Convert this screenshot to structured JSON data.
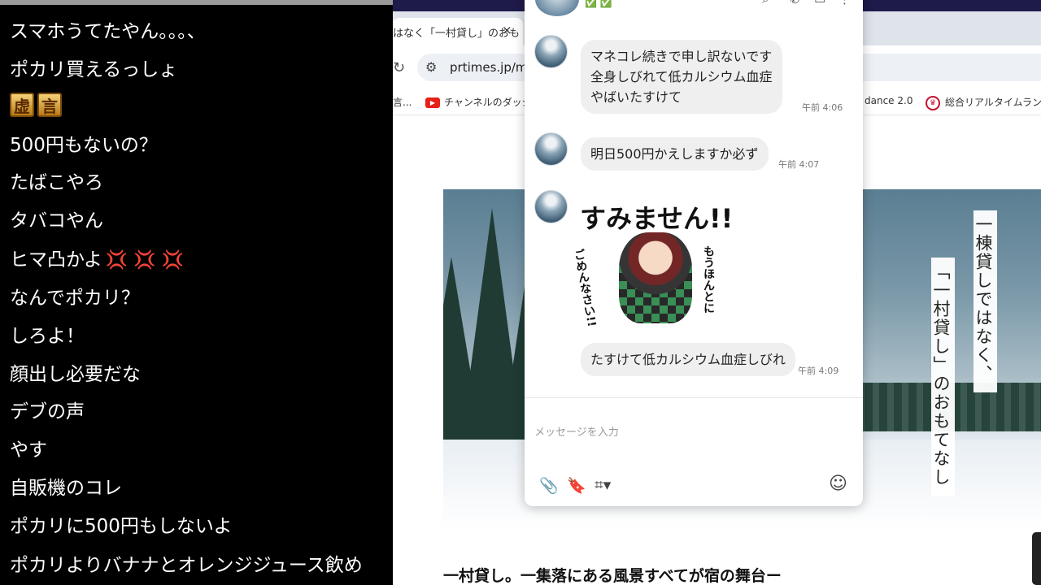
{
  "comments": [
    {
      "text": "スマホうてたやん。。。、"
    },
    {
      "text": "ポカリ買えるっしょ"
    },
    {
      "badge1": "虚",
      "badge2": "言"
    },
    {
      "text": "500円もないの？"
    },
    {
      "text": "たばこやろ"
    },
    {
      "text": "タバコやん"
    },
    {
      "text": "ヒマ凸かよ",
      "anger": "💢 💢 💢"
    },
    {
      "text": "なんでポカリ？"
    },
    {
      "text": "しろよ！"
    },
    {
      "text": "顔出し必要だな"
    },
    {
      "text": "デブの声"
    },
    {
      "text": "やす"
    },
    {
      "text": "自販機のコレ"
    },
    {
      "text": "ポカリに500円もしないよ"
    },
    {
      "text": "ポカリよりバナナとオレンジジュース飲め"
    }
  ],
  "browser": {
    "tab_title": "はなく「一村貸し」のおも",
    "tab_close": "×",
    "reload": "↻",
    "url": "prtimes.jp/ma",
    "bookmarks": {
      "item1": "言...",
      "item2": "チャンネルのダッシュ",
      "item3": "dance 2.0",
      "item4": "総合リアルタイムランキ"
    }
  },
  "hero": {
    "vertical_1": "一棟貸しではなく、",
    "vertical_2": "「一村貸し」のおもてなし"
  },
  "article": {
    "heading": "一村貸し。一集落にある風景すべてが宿の舞台ー"
  },
  "chat": {
    "header_name": "✅ ✅",
    "messages": [
      {
        "lines": [
          "マネコレ続きで申し訳ないです",
          "全身しびれて低カルシウム血症",
          "やばいたすけて"
        ],
        "time": "午前 4:06"
      },
      {
        "lines": [
          "明日500円かえしますか必ず"
        ],
        "time": "午前 4:07"
      },
      {
        "sticker_title": "すみません!!",
        "sticker_left": "ごめんなさい!!",
        "sticker_right": "もうほんとに"
      },
      {
        "lines": [
          "たすけて低カルシウム血症しびれ"
        ],
        "time": "午前 4:09"
      }
    ],
    "input_placeholder": "メッセージを入力",
    "tools": {
      "attach": "📎",
      "bookmark": "🔖",
      "crop": "⌗▾",
      "emoji": "☺"
    }
  },
  "colors": {
    "comment_bg": "#000000",
    "chat_bubble": "#efefef",
    "accent_green": "#3cba54"
  }
}
